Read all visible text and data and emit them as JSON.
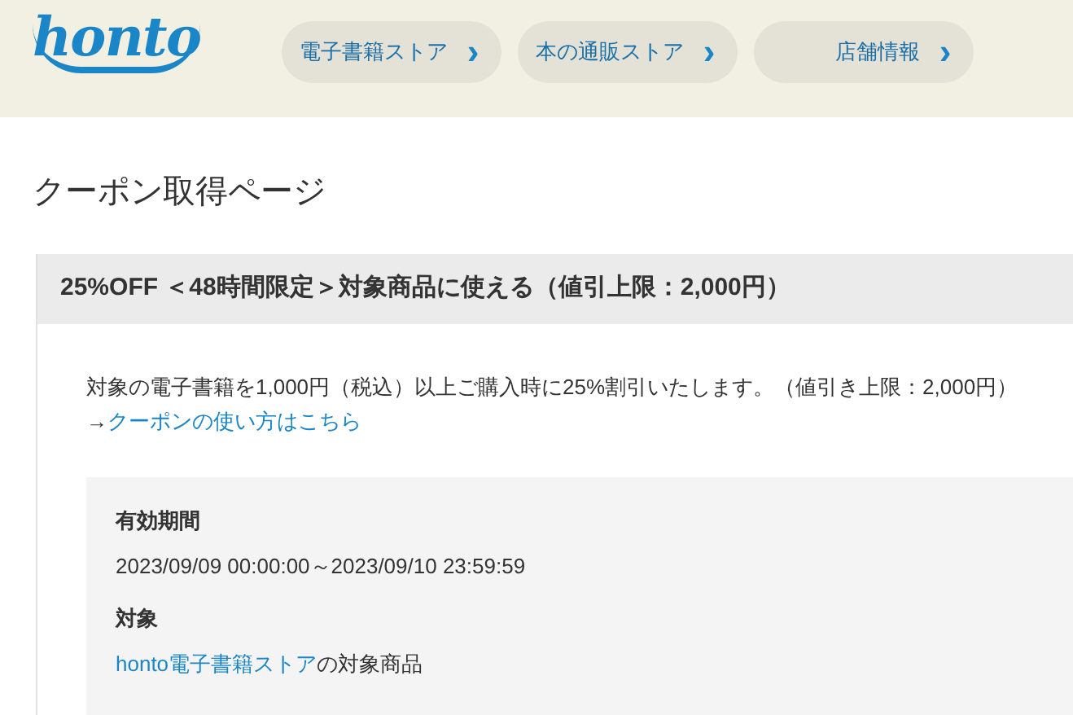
{
  "header": {
    "logo": "honto",
    "nav": [
      {
        "label": "電子書籍ストア",
        "icon": "›"
      },
      {
        "label": "本の通販ストア",
        "icon": "›"
      },
      {
        "label": "店舗情報",
        "icon": "›"
      }
    ]
  },
  "page_title": "クーポン取得ページ",
  "coupon": {
    "title": "25%OFF ＜48時間限定＞対象商品に使える（値引上限：2,000円）",
    "description": "対象の電子書籍を1,000円（税込）以上ご購入時に25%割引いたします。（値引き上限：2,000円）",
    "usage_link": {
      "arrow": "→",
      "label": "クーポンの使い方はこちら"
    },
    "details": [
      {
        "heading": "有効期間",
        "value": "2023/09/09 00:00:00～2023/09/10 23:59:59"
      },
      {
        "heading": "対象",
        "link": "honto電子書籍ストア",
        "value": "の対象商品"
      }
    ]
  }
}
